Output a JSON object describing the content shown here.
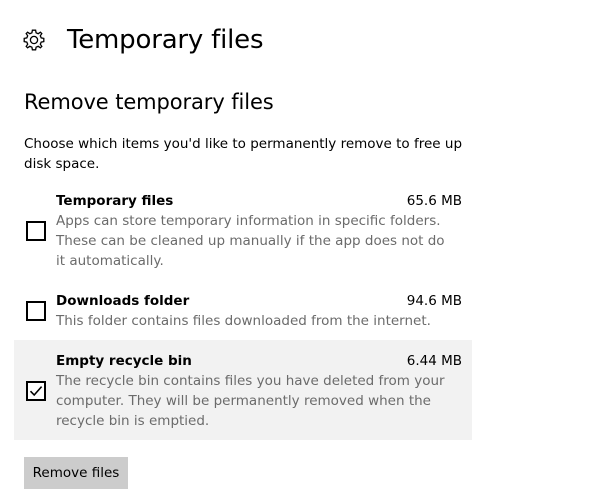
{
  "header": {
    "title": "Temporary files",
    "icon": "gear-icon"
  },
  "section": {
    "title": "Remove temporary files",
    "intro": "Choose which items you'd like to permanently remove to free up disk space."
  },
  "items": [
    {
      "name": "Temporary files",
      "size": "65.6 MB",
      "description": "Apps can store temporary information in specific folders. These can be cleaned up manually if the app does not do it automatically.",
      "checked": false
    },
    {
      "name": "Downloads folder",
      "size": "94.6 MB",
      "description": "This folder contains files downloaded from the internet.",
      "checked": false
    },
    {
      "name": "Empty recycle bin",
      "size": "6.44 MB",
      "description": "The recycle bin contains files you have deleted from your computer. They will be permanently removed when the recycle bin is emptied.",
      "checked": true
    }
  ],
  "actions": {
    "remove_label": "Remove files"
  }
}
